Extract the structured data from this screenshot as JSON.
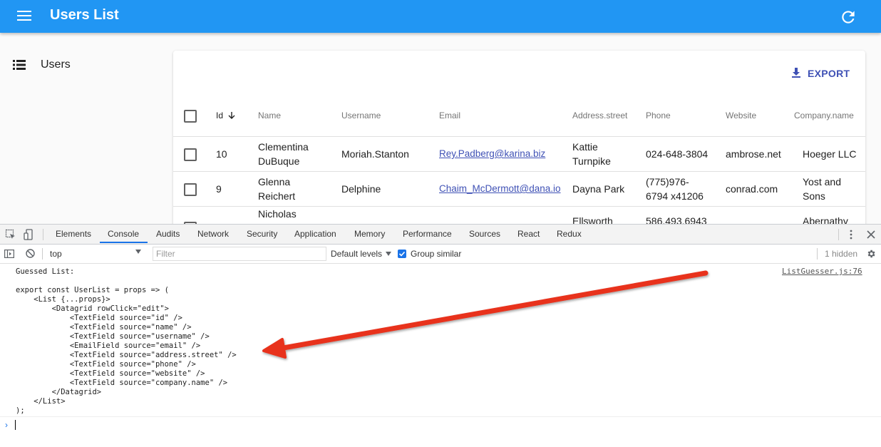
{
  "app": {
    "title": "Users List"
  },
  "sidebar": {
    "items": [
      {
        "label": "Users"
      }
    ]
  },
  "toolbar": {
    "export_label": "EXPORT"
  },
  "table": {
    "headers": [
      "Id",
      "Name",
      "Username",
      "Email",
      "Address.street",
      "Phone",
      "Website",
      "Company.name"
    ],
    "rows": [
      {
        "id": "10",
        "name_l1": "Clementina",
        "name_l2": "DuBuque",
        "username": "Moriah.Stanton",
        "email": "Rey.Padberg@karina.biz",
        "street_l1": "Kattie",
        "street_l2": "Turnpike",
        "phone_l1": "024-648-3804",
        "phone_l2": "",
        "website": "ambrose.net",
        "company_l1": "Hoeger LLC",
        "company_l2": ""
      },
      {
        "id": "9",
        "name_l1": "Glenna",
        "name_l2": "Reichert",
        "username": "Delphine",
        "email": "Chaim_McDermott@dana.io",
        "street_l1": "Dayna Park",
        "street_l2": "",
        "phone_l1": "(775)976-",
        "phone_l2": "6794 x41206",
        "website": "conrad.com",
        "company_l1": "Yost and",
        "company_l2": "Sons"
      },
      {
        "name_l1": "Nicholas",
        "street_l1": "Ellsworth",
        "phone_l1": "586.493.6943",
        "company_l1": "Abernathy"
      }
    ]
  },
  "devtools": {
    "tabs": [
      "Elements",
      "Console",
      "Audits",
      "Network",
      "Security",
      "Application",
      "Memory",
      "Performance",
      "Sources",
      "React",
      "Redux"
    ],
    "active_tab": "Console",
    "context": "top",
    "filter_placeholder": "Filter",
    "levels": "Default levels",
    "group_similar": "Group similar",
    "group_similar_checked": true,
    "hidden_count": "1 hidden",
    "source": "ListGuesser.js:76",
    "log_lines": [
      "Guessed List:",
      "",
      "export const UserList = props => (",
      "    <List {...props}>",
      "        <Datagrid rowClick=\"edit\">",
      "            <TextField source=\"id\" />",
      "            <TextField source=\"name\" />",
      "            <TextField source=\"username\" />",
      "            <EmailField source=\"email\" />",
      "            <TextField source=\"address.street\" />",
      "            <TextField source=\"phone\" />",
      "            <TextField source=\"website\" />",
      "            <TextField source=\"company.name\" />",
      "        </Datagrid>",
      "    </List>",
      ");"
    ]
  },
  "colors": {
    "appbar": "#2196f3",
    "accent": "#3f51b5",
    "arrow": "#e8321e"
  },
  "icons": [
    "menu-icon",
    "refresh-icon",
    "list-icon",
    "download-icon",
    "sort-arrow-icon",
    "inspect-icon",
    "device-icon",
    "more-icon",
    "close-icon",
    "sidebar-toggle-icon",
    "clear-icon",
    "gear-icon"
  ]
}
